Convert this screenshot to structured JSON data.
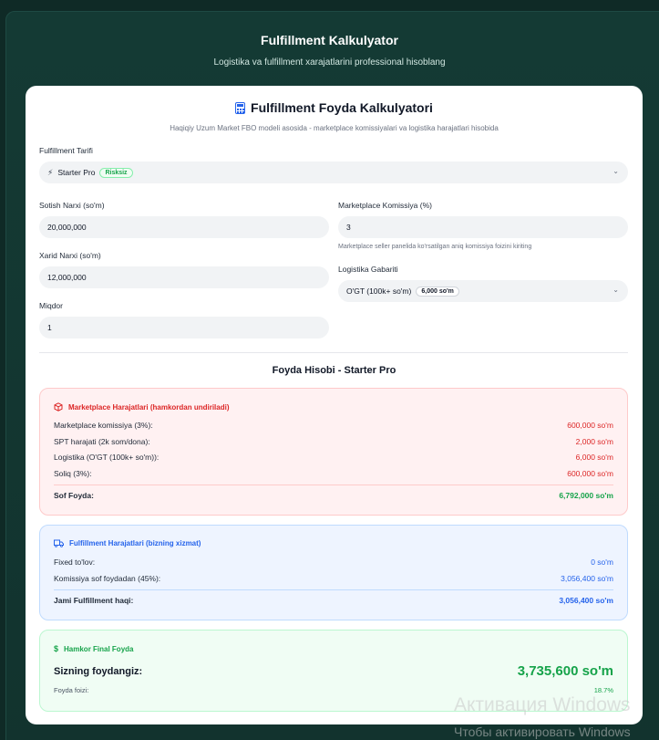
{
  "header": {
    "title": "Fulfillment Kalkulyator",
    "subtitle": "Logistika va fulfillment xarajatlarini professional hisoblang"
  },
  "calculator": {
    "title": "Fulfillment Foyda Kalkulyatori",
    "subtitle": "Haqiqiy Uzum Market FBO modeli asosida - marketplace komissiyalari va logistika harajatlari hisobida",
    "tariff_label": "Fulfillment Tarifi",
    "tariff_value": "Starter Pro",
    "tariff_badge": "Risksiz",
    "price_label": "Sotish Narxi (so'm)",
    "price_value": "20,000,000",
    "purchase_label": "Xarid Narxi (so'm)",
    "purchase_value": "12,000,000",
    "qty_label": "Miqdor",
    "qty_value": "1",
    "commission_label": "Marketplace Komissiya (%)",
    "commission_value": "3",
    "commission_hint": "Marketplace seller panelida ko'rsatilgan aniq komissiya foizini kiriting",
    "logistics_label": "Logistika Gabariti",
    "logistics_value": "O'GT (100k+ so'm)",
    "logistics_badge": "6,000 so'm"
  },
  "result": {
    "title": "Foyda Hisobi - Starter Pro",
    "marketplace": {
      "heading": "Marketplace Harajatlari (hamkordan undiriladi)",
      "rows": [
        {
          "label": "Marketplace komissiya (3%):",
          "value": "600,000 so'm"
        },
        {
          "label": "SPT harajati (2k som/dona):",
          "value": "2,000 so'm"
        },
        {
          "label": "Logistika (O'GT (100k+ so'm)):",
          "value": "6,000 so'm"
        },
        {
          "label": "Soliq (3%):",
          "value": "600,000 so'm"
        }
      ],
      "total_label": "Sof Foyda:",
      "total_value": "6,792,000 so'm"
    },
    "fulfillment": {
      "heading": "Fulfillment Harajatlari (bizning xizmat)",
      "rows": [
        {
          "label": "Fixed to'lov:",
          "value": "0 so'm"
        },
        {
          "label": "Komissiya sof foydadan (45%):",
          "value": "3,056,400 so'm"
        }
      ],
      "total_label": "Jami Fulfillment haqi:",
      "total_value": "3,056,400 so'm"
    },
    "final": {
      "heading": "Hamkor Final Foyda",
      "profit_label": "Sizning foydangiz:",
      "profit_value": "3,735,600 so'm",
      "percent_label": "Foyda foizi:",
      "percent_value": "18.7%"
    }
  },
  "watermark": {
    "line1": "Активация Windows",
    "line2": "Чтобы активировать Windows"
  },
  "colors": {
    "background": "#0f2a26",
    "red": "#dc2626",
    "blue": "#2563eb",
    "green": "#16a34a"
  }
}
